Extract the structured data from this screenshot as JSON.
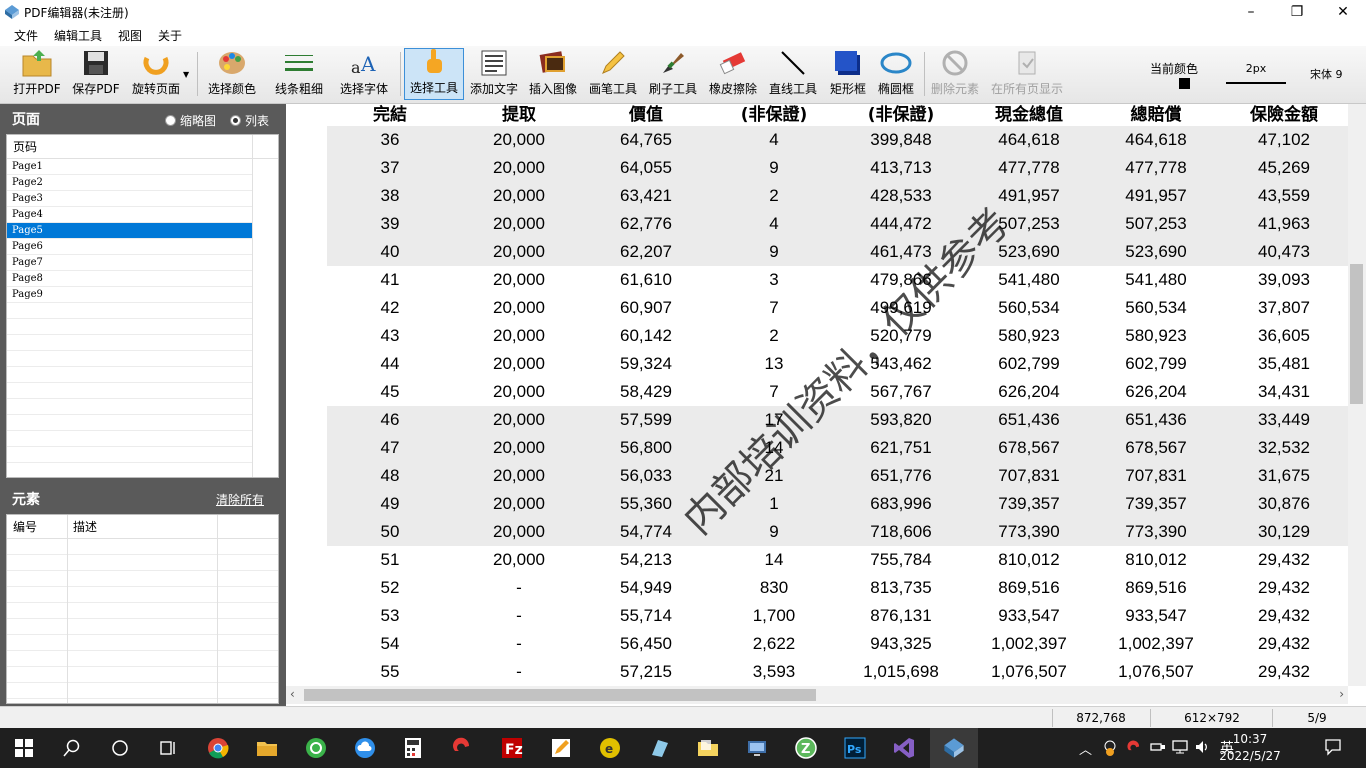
{
  "window": {
    "title": "PDF编辑器(未注册)",
    "minimize": "–",
    "maximize": "❐",
    "close": "✕"
  },
  "menu": [
    "文件",
    "编辑工具",
    "视图",
    "关于"
  ],
  "toolbar": {
    "tools": [
      {
        "name": "open-pdf-button",
        "label": "打开PDF",
        "icon": "folder-icon"
      },
      {
        "name": "save-pdf-button",
        "label": "保存PDF",
        "icon": "floppy-icon"
      },
      {
        "name": "rotate-page-button",
        "label": "旋转页面",
        "icon": "rotate-icon"
      },
      {
        "name": "select-color-button",
        "label": "选择颜色",
        "icon": "palette-icon"
      },
      {
        "name": "line-width-button",
        "label": "线条粗细",
        "icon": "line-width-icon"
      },
      {
        "name": "select-font-button",
        "label": "选择字体",
        "icon": "font-icon"
      },
      {
        "name": "select-tool-button",
        "label": "选择工具",
        "icon": "hand-pointer-icon"
      },
      {
        "name": "add-text-button",
        "label": "添加文字",
        "icon": "text-block-icon"
      },
      {
        "name": "insert-image-button",
        "label": "插入图像",
        "icon": "image-icon"
      },
      {
        "name": "pen-tool-button",
        "label": "画笔工具",
        "icon": "pencil-icon"
      },
      {
        "name": "brush-tool-button",
        "label": "刷子工具",
        "icon": "brush-icon"
      },
      {
        "name": "eraser-button",
        "label": "橡皮擦除",
        "icon": "eraser-icon"
      },
      {
        "name": "line-tool-button",
        "label": "直线工具",
        "icon": "line-icon"
      },
      {
        "name": "rectangle-tool-button",
        "label": "矩形框",
        "icon": "rectangle-icon"
      },
      {
        "name": "ellipse-tool-button",
        "label": "椭圆框",
        "icon": "ellipse-icon"
      },
      {
        "name": "delete-element-button",
        "label": "删除元素",
        "icon": "delete-icon"
      },
      {
        "name": "show-all-pages-button",
        "label": "在所有页显示",
        "icon": "copy-pages-icon"
      }
    ],
    "current_color_label": "当前颜色",
    "current_color": "#000000",
    "pen_size": "2px",
    "font": "宋体 9"
  },
  "pages_panel": {
    "title": "页面",
    "view_thumbnail": "缩略图",
    "view_list": "列表",
    "column": "页码",
    "pages": [
      "Page1",
      "Page2",
      "Page3",
      "Page4",
      "Page5",
      "Page6",
      "Page7",
      "Page8",
      "Page9"
    ],
    "selected": "Page5"
  },
  "elements_panel": {
    "title": "元素",
    "clear_all": "清除所有",
    "col_id": "编号",
    "col_desc": "描述"
  },
  "document": {
    "headers": [
      "完結",
      "提取",
      "價值",
      "(非保證)",
      "(非保證)",
      "現金總值",
      "總賠償",
      "保險金額"
    ],
    "rows": [
      [
        "36",
        "20,000",
        "64,765",
        "4",
        "399,848",
        "464,618",
        "464,618",
        "47,102"
      ],
      [
        "37",
        "20,000",
        "64,055",
        "9",
        "413,713",
        "477,778",
        "477,778",
        "45,269"
      ],
      [
        "38",
        "20,000",
        "63,421",
        "2",
        "428,533",
        "491,957",
        "491,957",
        "43,559"
      ],
      [
        "39",
        "20,000",
        "62,776",
        "4",
        "444,472",
        "507,253",
        "507,253",
        "41,963"
      ],
      [
        "40",
        "20,000",
        "62,207",
        "9",
        "461,473",
        "523,690",
        "523,690",
        "40,473"
      ],
      [
        "41",
        "20,000",
        "61,610",
        "3",
        "479,866",
        "541,480",
        "541,480",
        "39,093"
      ],
      [
        "42",
        "20,000",
        "60,907",
        "7",
        "499,619",
        "560,534",
        "560,534",
        "37,807"
      ],
      [
        "43",
        "20,000",
        "60,142",
        "2",
        "520,779",
        "580,923",
        "580,923",
        "36,605"
      ],
      [
        "44",
        "20,000",
        "59,324",
        "13",
        "543,462",
        "602,799",
        "602,799",
        "35,481"
      ],
      [
        "45",
        "20,000",
        "58,429",
        "7",
        "567,767",
        "626,204",
        "626,204",
        "34,431"
      ],
      [
        "46",
        "20,000",
        "57,599",
        "17",
        "593,820",
        "651,436",
        "651,436",
        "33,449"
      ],
      [
        "47",
        "20,000",
        "56,800",
        "14",
        "621,751",
        "678,567",
        "678,567",
        "32,532"
      ],
      [
        "48",
        "20,000",
        "56,033",
        "21",
        "651,776",
        "707,831",
        "707,831",
        "31,675"
      ],
      [
        "49",
        "20,000",
        "55,360",
        "1",
        "683,996",
        "739,357",
        "739,357",
        "30,876"
      ],
      [
        "50",
        "20,000",
        "54,774",
        "9",
        "718,606",
        "773,390",
        "773,390",
        "30,129"
      ],
      [
        "51",
        "20,000",
        "54,213",
        "14",
        "755,784",
        "810,012",
        "810,012",
        "29,432"
      ],
      [
        "52",
        "-",
        "54,949",
        "830",
        "813,735",
        "869,516",
        "869,516",
        "29,432"
      ],
      [
        "53",
        "-",
        "55,714",
        "1,700",
        "876,131",
        "933,547",
        "933,547",
        "29,432"
      ],
      [
        "54",
        "-",
        "56,450",
        "2,622",
        "943,325",
        "1,002,397",
        "1,002,397",
        "29,432"
      ],
      [
        "55",
        "-",
        "57,215",
        "3,593",
        "1,015,698",
        "1,076,507",
        "1,076,507",
        "29,432"
      ]
    ],
    "watermark": "内部培训资料，仅供参考"
  },
  "status": {
    "coords": "872,768",
    "page_size": "612×792",
    "page": "5/9"
  },
  "taskbar": {
    "time": "10:37",
    "date": "2022/5/27",
    "ime": "英",
    "apps": [
      "start-icon",
      "search-icon",
      "cortana-icon",
      "task-view-icon",
      "chrome-icon",
      "file-explorer-icon",
      "browser-360-icon",
      "cloud-icon",
      "calculator-icon",
      "app-red-icon",
      "filezilla-icon",
      "editor-icon",
      "e-app-icon",
      "tool-app-icon",
      "folder-app-icon",
      "remote-icon",
      "z-app-icon",
      "photoshop-icon",
      "visual-studio-icon",
      "pdf-editor-icon"
    ]
  }
}
